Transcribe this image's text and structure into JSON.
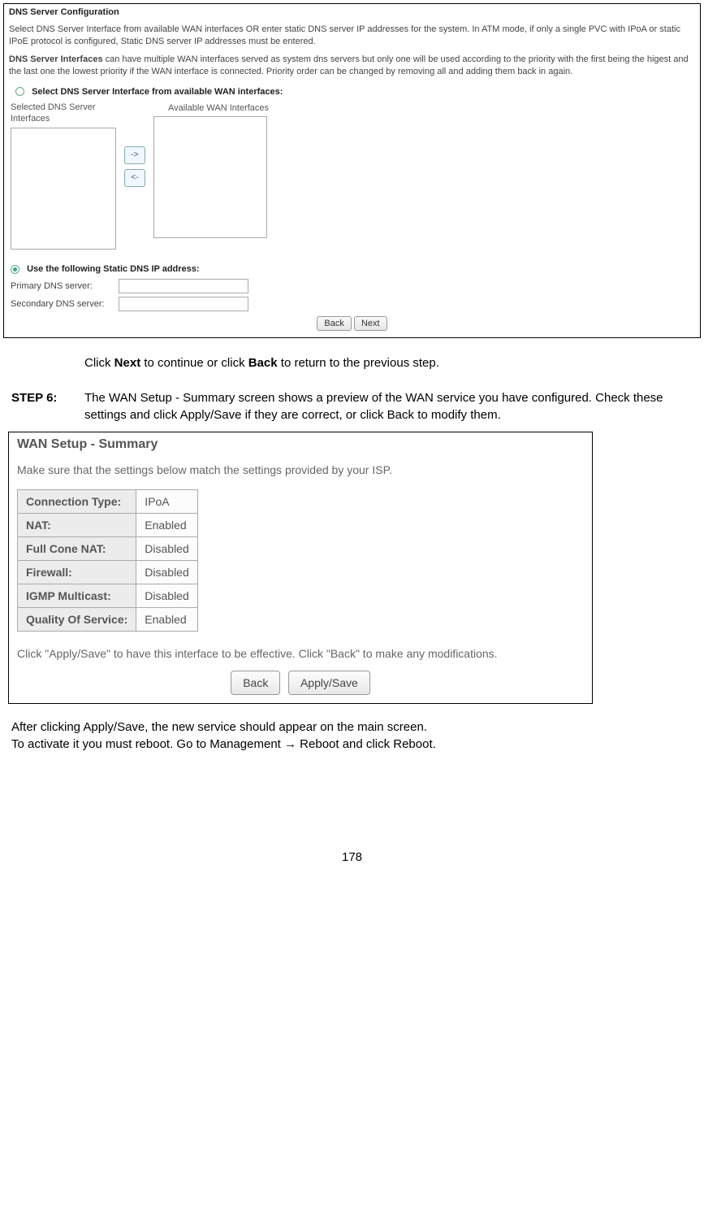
{
  "dns_panel": {
    "title": "DNS Server Configuration",
    "desc1_a": "Select DNS Server Interface from available WAN interfaces OR enter static DNS server IP addresses for the system. In ATM mode, if only a single PVC with IPoA or static IPoE protocol is configured, Static DNS server IP addresses must be entered.",
    "desc2_lead": "DNS Server Interfaces",
    "desc2_rest": " can have multiple WAN interfaces served as system dns servers but only one will be used according to the priority with the first being the higest and the last one the lowest priority if the WAN interface is connected. Priority order can be changed by removing all and adding them back in again.",
    "opt1": "Select DNS Server Interface from available WAN interfaces:",
    "col1": "Selected DNS Server Interfaces",
    "col2": "Available WAN Interfaces",
    "move_right": "->",
    "move_left": "<-",
    "opt2": "Use the following Static DNS IP address:",
    "primary": "Primary DNS server:",
    "secondary": "Secondary DNS server:",
    "back": "Back",
    "next": "Next"
  },
  "mid": {
    "line1_a": "Click ",
    "line1_b": "Next",
    "line1_c": " to continue or click ",
    "line1_d": "Back",
    "line1_e": " to return to the previous step.",
    "step_label": "STEP 6:",
    "step_text_a": "The WAN Setup - Summary screen shows a preview of the WAN service you have configured. Check these settings and click ",
    "step_text_b": "Apply/Save",
    "step_text_c": " if they are correct, or click ",
    "step_text_d": "Back",
    "step_text_e": " to modify them."
  },
  "summary_panel": {
    "title": "WAN Setup - Summary",
    "desc": "Make sure that the settings below match the settings provided by your ISP.",
    "rows": [
      {
        "k": "Connection Type:",
        "v": "IPoA"
      },
      {
        "k": "NAT:",
        "v": "Enabled"
      },
      {
        "k": "Full Cone NAT:",
        "v": "Disabled"
      },
      {
        "k": "Firewall:",
        "v": "Disabled"
      },
      {
        "k": "IGMP Multicast:",
        "v": "Disabled"
      },
      {
        "k": "Quality Of Service:",
        "v": "Enabled"
      }
    ],
    "desc2": "Click \"Apply/Save\" to have this interface to be effective. Click \"Back\" to make any modifications.",
    "back": "Back",
    "apply": "Apply/Save"
  },
  "after": {
    "line1_a": "After clicking ",
    "line1_b": "Apply/Save",
    "line1_c": ", the new service should appear on the main screen.",
    "line2_a": "To activate it you must reboot. Go to Management ",
    "line2_arrow": "→",
    "line2_b": " Reboot and click ",
    "line2_c": "Reboot",
    "line2_d": "."
  },
  "page_number": "178"
}
